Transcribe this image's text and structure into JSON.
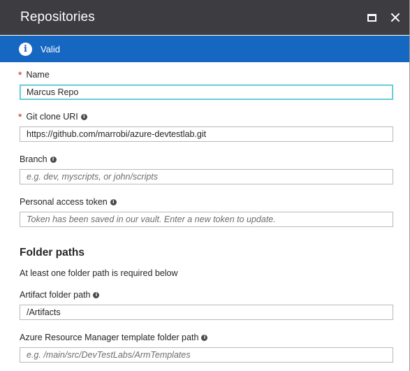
{
  "window": {
    "title": "Repositories",
    "maximize_icon": "maximize-icon",
    "close_icon": "close-icon"
  },
  "status": {
    "icon": "info-icon",
    "glyph": "i",
    "text": "Valid",
    "color": "#1667c2"
  },
  "fields": {
    "name": {
      "label": "Name",
      "required": "*",
      "value": "Marcus Repo"
    },
    "git_uri": {
      "label": "Git clone URI",
      "required": "*",
      "info": "i",
      "value": "https://github.com/marrobi/azure-devtestlab.git"
    },
    "branch": {
      "label": "Branch",
      "info": "i",
      "placeholder": "e.g. dev, myscripts, or john/scripts"
    },
    "token": {
      "label": "Personal access token",
      "info": "i",
      "placeholder": "Token has been saved in our vault. Enter a new token to update."
    }
  },
  "folder_paths": {
    "title": "Folder paths",
    "note": "At least one folder path is required below",
    "artifact": {
      "label": "Artifact folder path",
      "info": "i",
      "value": "/Artifacts"
    },
    "arm": {
      "label": "Azure Resource Manager template folder path",
      "info": "i",
      "placeholder": "e.g. /main/src/DevTestLabs/ArmTemplates"
    }
  },
  "colors": {
    "titlebar": "#3c3c41",
    "accent": "#1667c2",
    "required": "#c41e1e",
    "focus": "#52c3d2"
  }
}
